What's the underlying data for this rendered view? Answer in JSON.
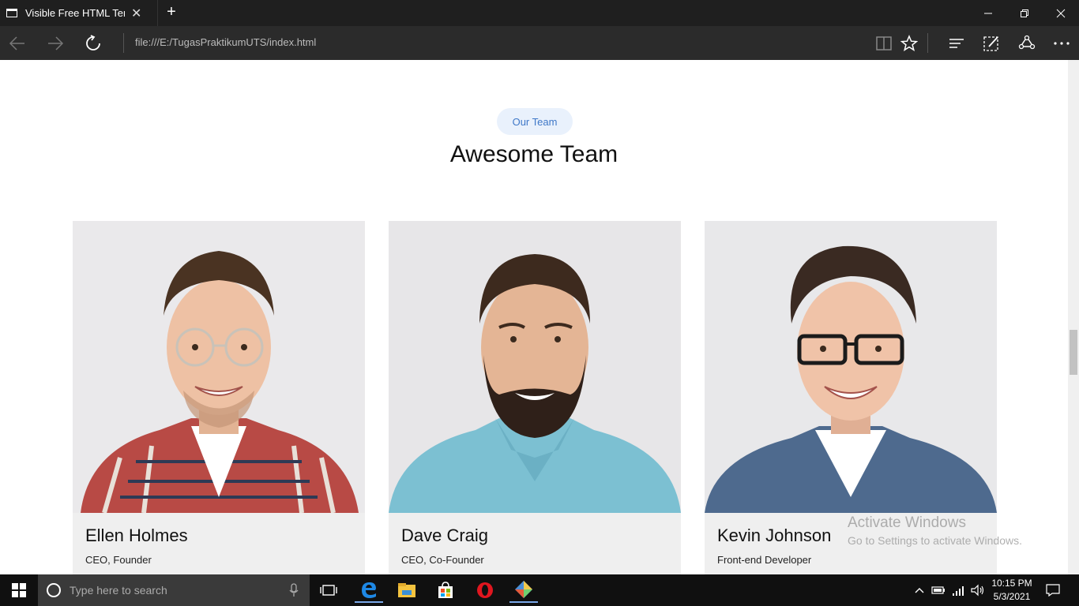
{
  "browser": {
    "tab_title": "Visible Free HTML Temp",
    "url": "file:///E:/TugasPraktikumUTS/index.html"
  },
  "section": {
    "badge": "Our Team",
    "heading": "Awesome Team"
  },
  "team": [
    {
      "name": "Ellen Holmes",
      "role": "CEO, Founder"
    },
    {
      "name": "Dave Craig",
      "role": "CEO, Co-Founder"
    },
    {
      "name": "Kevin Johnson",
      "role": "Front-end Developer"
    }
  ],
  "watermark": {
    "line1": "Activate Windows",
    "line2": "Go to Settings to activate Windows."
  },
  "taskbar": {
    "search_placeholder": "Type here to search",
    "time": "10:15 PM",
    "date": "5/3/2021"
  },
  "colors": {
    "badge_bg": "#e9f1fc",
    "badge_text": "#3f78c8",
    "card_bg": "#efefef"
  }
}
